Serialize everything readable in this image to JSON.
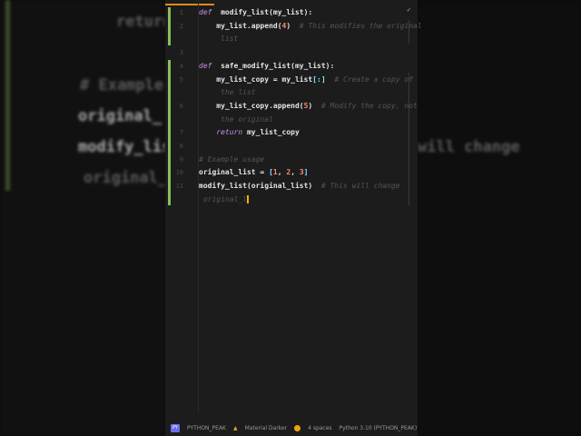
{
  "background_text": [
    "return",
    "# Example",
    "original_",
    "modify_lis",
    "will change",
    "original_"
  ],
  "editor": {
    "lines": [
      {
        "n": "1",
        "parts": [
          [
            "kw",
            "def"
          ],
          [
            "",
            "  modify_list(my_list):"
          ]
        ]
      },
      {
        "n": "2",
        "parts": [
          [
            "",
            "    my_list.append("
          ],
          [
            "num",
            "4"
          ],
          [
            "",
            ")  "
          ],
          [
            "cm",
            "# This modifies the original"
          ]
        ]
      },
      {
        "n": "",
        "parts": [
          [
            "cm",
            "     list"
          ]
        ]
      },
      {
        "n": "3",
        "parts": []
      },
      {
        "n": "4",
        "parts": [
          [
            "kw",
            "def"
          ],
          [
            "",
            "  safe_modify_list(my_list):"
          ]
        ]
      },
      {
        "n": "5",
        "parts": [
          [
            "",
            "    my_list_copy = my_list"
          ],
          [
            "br",
            "[:]"
          ],
          [
            "",
            "  "
          ],
          [
            "cm",
            "# Create a copy of"
          ]
        ]
      },
      {
        "n": "",
        "parts": [
          [
            "cm",
            "     the list"
          ]
        ]
      },
      {
        "n": "6",
        "parts": [
          [
            "",
            "    my_list_copy.append("
          ],
          [
            "num",
            "5"
          ],
          [
            "",
            ")  "
          ],
          [
            "cm",
            "# Modify the copy, not"
          ]
        ]
      },
      {
        "n": "",
        "parts": [
          [
            "cm",
            "     the original"
          ]
        ]
      },
      {
        "n": "7",
        "parts": [
          [
            "",
            "    "
          ],
          [
            "kw",
            "return"
          ],
          [
            "",
            " my_list_copy"
          ]
        ]
      },
      {
        "n": "8",
        "parts": []
      },
      {
        "n": "9",
        "parts": [
          [
            "cm",
            "# Example usage"
          ]
        ]
      },
      {
        "n": "10",
        "parts": [
          [
            "",
            "original_list = "
          ],
          [
            "br",
            "["
          ],
          [
            "num",
            "1"
          ],
          [
            "",
            ", "
          ],
          [
            "num",
            "2"
          ],
          [
            "",
            ", "
          ],
          [
            "num",
            "3"
          ],
          [
            "br",
            "]"
          ]
        ]
      },
      {
        "n": "11",
        "parts": [
          [
            "",
            "modify_list(original_list)  "
          ],
          [
            "cm",
            "# This will change"
          ]
        ]
      },
      {
        "n": "",
        "parts": [
          [
            "cm",
            " original_l"
          ]
        ]
      }
    ]
  },
  "status": {
    "project_icon": "PY",
    "project": "PYTHON_PEAK",
    "theme": "Material Darker",
    "indent": "4 spaces",
    "interpreter": "Python 3.10 (PYTHON_PEAK)"
  }
}
